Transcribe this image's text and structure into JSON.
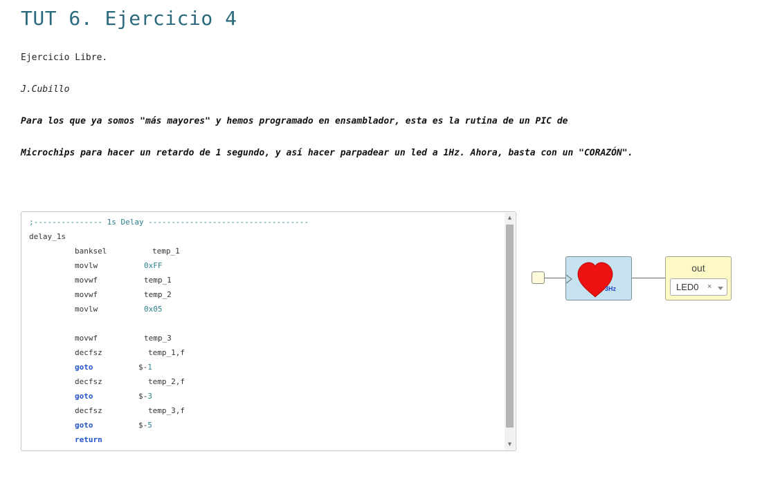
{
  "page": {
    "title": "TUT 6. Ejercicio 4",
    "paragraphs": [
      "Ejercicio Libre.",
      "J.Cubillo",
      "Para los que ya somos \"más mayores\" y hemos programado en ensamblador, esta es la rutina de un PIC de",
      "Microchips para hacer un retardo de 1 segundo, y así hacer parpadear un led a 1Hz. Ahora, basta con un \"CORAZÓN\"."
    ]
  },
  "code_editor": {
    "lines": [
      {
        "comment": ";--------------- 1s Delay -----------------------------------"
      },
      {
        "label": "delay_1s"
      },
      {
        "instr": "banksel",
        "op": "temp_1",
        "op_type": "operand",
        "op_pad": "wide"
      },
      {
        "instr": "movlw",
        "op": "0xFF",
        "op_type": "number",
        "op_pad": "mid"
      },
      {
        "instr": "movwf",
        "op": "temp_1",
        "op_type": "operand",
        "op_pad": "mid"
      },
      {
        "instr": "movwf",
        "op": "temp_2",
        "op_type": "operand",
        "op_pad": "mid"
      },
      {
        "instr": "movlw",
        "op": "0x05",
        "op_type": "number",
        "op_pad": "mid"
      },
      {},
      {
        "instr": "movwf",
        "op": "temp_3",
        "op_type": "operand",
        "op_pad": "mid"
      },
      {
        "instr": "decfsz",
        "op": "temp_1,f",
        "op_type": "operand",
        "op_pad": "wider"
      },
      {
        "instr": "goto",
        "instr_type": "keyword",
        "op": "$-1",
        "op_type": "mixed",
        "op_pad": "narrow"
      },
      {
        "instr": "decfsz",
        "op": "temp_2,f",
        "op_type": "operand",
        "op_pad": "wider"
      },
      {
        "instr": "goto",
        "instr_type": "keyword",
        "op": "$-3",
        "op_type": "mixed",
        "op_pad": "narrow"
      },
      {
        "instr": "decfsz",
        "op": "temp_3,f",
        "op_type": "operand",
        "op_pad": "wider"
      },
      {
        "instr": "goto",
        "instr_type": "keyword",
        "op": "$-5",
        "op_type": "mixed",
        "op_pad": "narrow"
      },
      {
        "instr": "return",
        "instr_type": "keyword"
      }
    ]
  },
  "circuit": {
    "heart_block": {
      "frequency_label": "3Hz",
      "icon": "heart-icon",
      "heart_color": "#ee1111"
    },
    "output_block": {
      "label": "out",
      "select_value": "LED0",
      "clear_glyph": "×"
    }
  },
  "colors": {
    "title": "#2a6a7c",
    "comment": "#2a7f8f",
    "keyword": "#2255cc",
    "heart_block_bg": "#c6e2ee",
    "output_block_bg": "#fdf9c6"
  }
}
